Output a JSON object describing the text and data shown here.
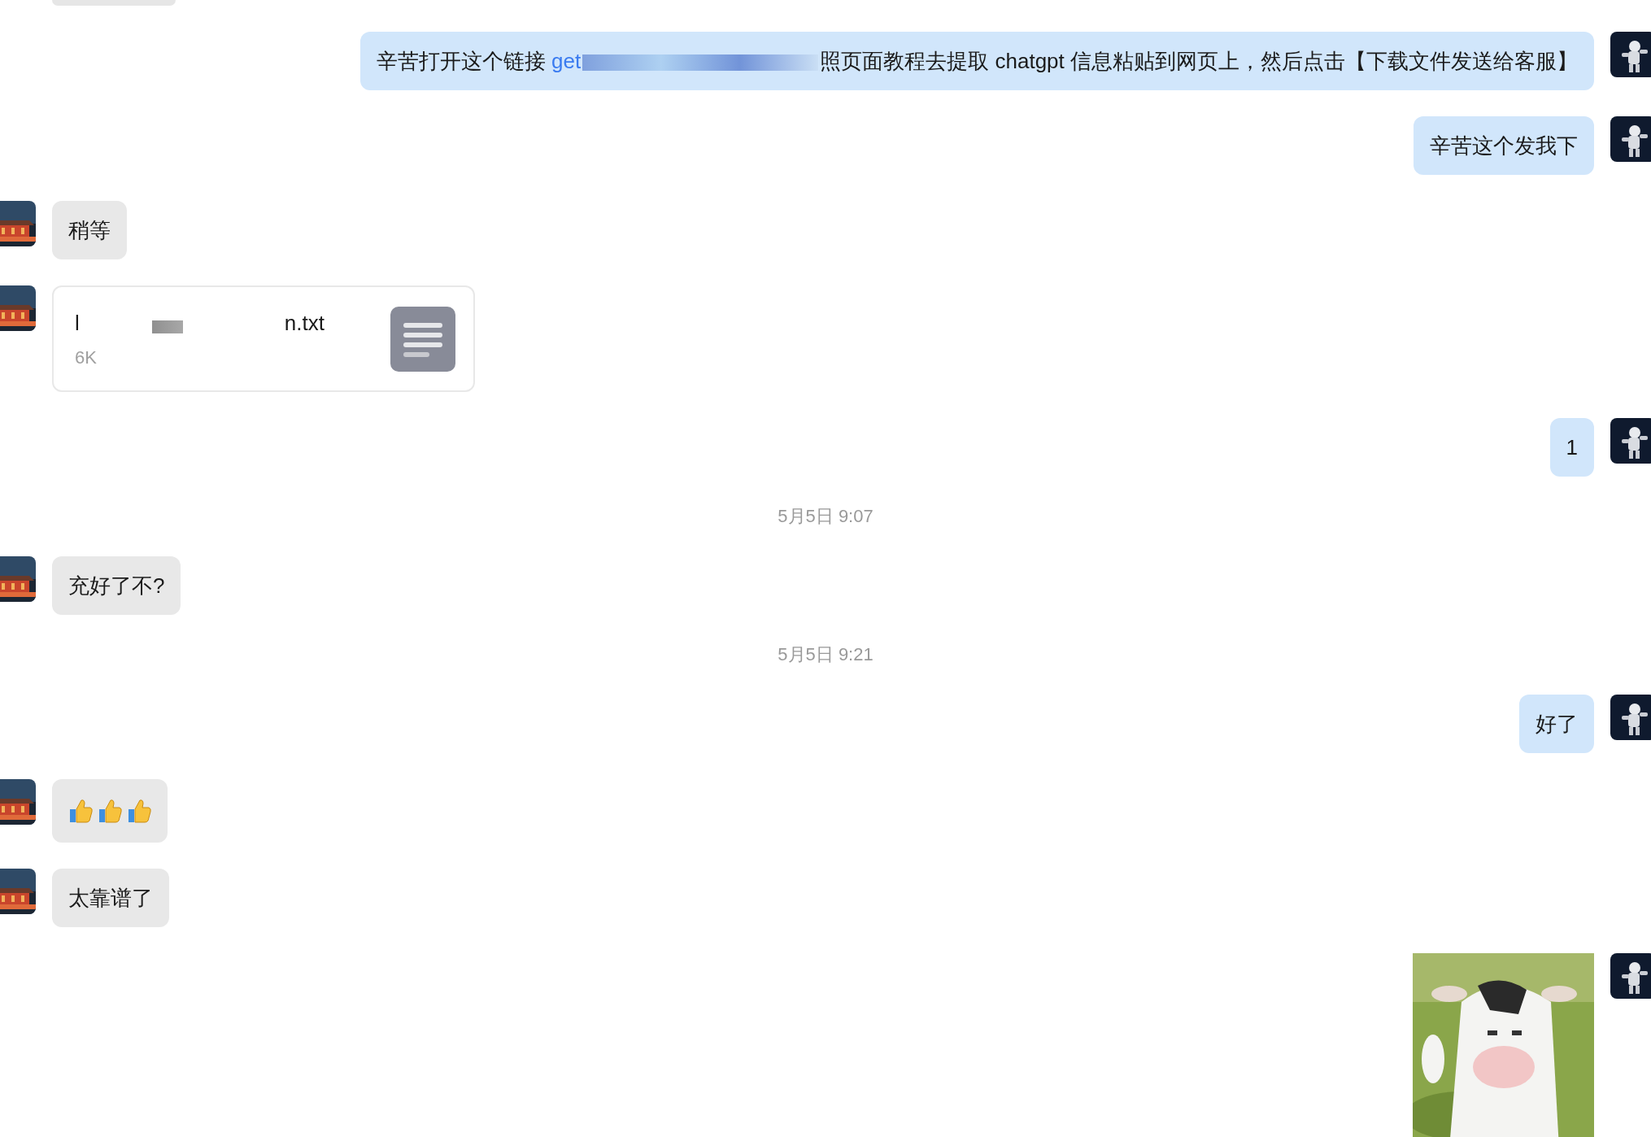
{
  "messages": [
    {
      "kind": "partial",
      "from_me": false
    },
    {
      "kind": "link_text",
      "from_me": true,
      "before": "辛苦打开这个链接",
      "link": "get",
      "after": "照页面教程去提取 chatgpt 信息粘贴到网页上，然后点击【下载文件发送给客服】"
    },
    {
      "kind": "text",
      "from_me": true,
      "text": "辛苦这个发我下"
    },
    {
      "kind": "text",
      "from_me": false,
      "text": "稍等"
    },
    {
      "kind": "file",
      "from_me": false,
      "name_start": "l",
      "name_end": "n.txt",
      "size": "6K"
    },
    {
      "kind": "text",
      "from_me": true,
      "text": "1"
    },
    {
      "kind": "timestamp",
      "text": "5月5日 9:07"
    },
    {
      "kind": "text",
      "from_me": false,
      "text": "充好了不?"
    },
    {
      "kind": "timestamp",
      "text": "5月5日 9:21"
    },
    {
      "kind": "text",
      "from_me": true,
      "text": "好了"
    },
    {
      "kind": "thumbs",
      "from_me": false,
      "icons": [
        {
          "kind": "thumbs_up"
        },
        {
          "kind": "thumbs_up"
        },
        {
          "kind": "thumbs_up"
        }
      ]
    },
    {
      "kind": "text",
      "from_me": false,
      "text": "太靠谱了"
    },
    {
      "kind": "sticker",
      "from_me": true
    }
  ]
}
